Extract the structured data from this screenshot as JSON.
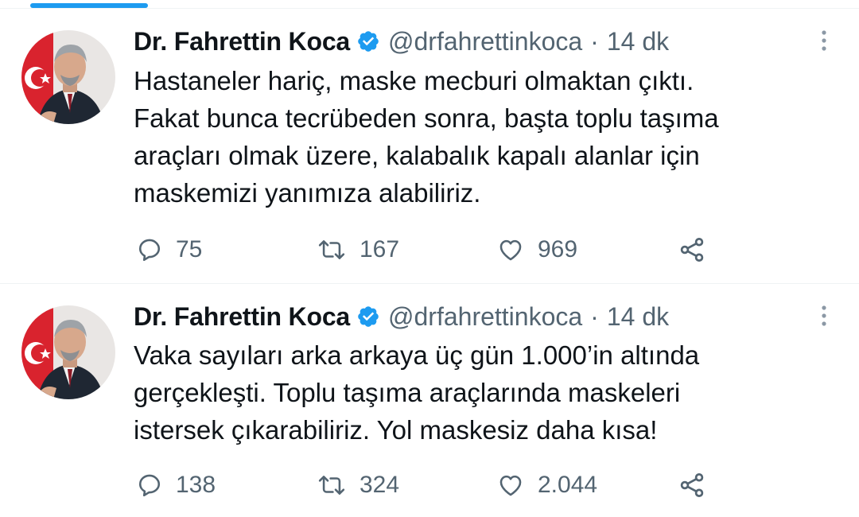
{
  "colors": {
    "accent": "#1d9bf0",
    "text_primary": "#0f1419",
    "text_secondary": "#536471",
    "divider": "#eff3f4"
  },
  "tweets": [
    {
      "author_name": "Dr. Fahrettin Koca",
      "handle": "@drfahrettinkoca",
      "separator": "·",
      "time": "14 dk",
      "lines": [
        "Hastaneler hariç, maske mecburi olmaktan çıktı.",
        "Fakat bunca tecrübeden sonra, başta toplu taşıma",
        "araçları olmak üzere, kalabalık kapalı alanlar için",
        "maskemizi yanımıza alabiliriz."
      ],
      "replies": "75",
      "retweets": "167",
      "likes": "969",
      "icons": [
        "verified-badge-icon",
        "more-options-icon",
        "reply-icon",
        "retweet-icon",
        "like-icon",
        "share-icon"
      ]
    },
    {
      "author_name": "Dr. Fahrettin Koca",
      "handle": "@drfahrettinkoca",
      "separator": "·",
      "time": "14 dk",
      "lines": [
        "Vaka sayıları arka arkaya üç gün 1.000’in altında",
        "gerçekleşti. Toplu taşıma araçlarında maskeleri",
        "istersek çıkarabiliriz. Yol maskesiz daha kısa!"
      ],
      "replies": "138",
      "retweets": "324",
      "likes": "2.044",
      "icons": [
        "verified-badge-icon",
        "more-options-icon",
        "reply-icon",
        "retweet-icon",
        "like-icon",
        "share-icon"
      ]
    }
  ]
}
